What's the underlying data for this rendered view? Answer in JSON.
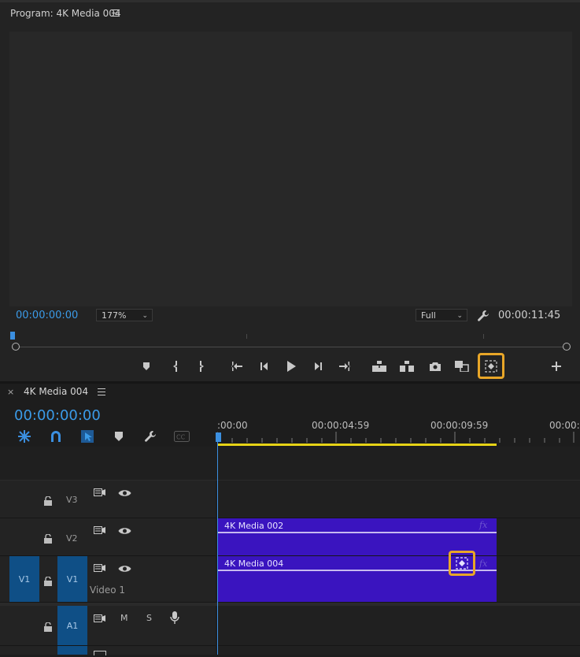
{
  "program": {
    "title": "Program: 4K Media 004",
    "timecode": "00:00:00:00",
    "zoom": "177%",
    "quality": "Full",
    "duration": "00:00:11:45"
  },
  "timeline": {
    "tab_title": "4K Media 004",
    "close": "×",
    "timecode": "00:00:00:00",
    "ruler": [
      ":00:00",
      "00:00:04:59",
      "00:00:09:59",
      "00:00:1"
    ],
    "tracks": {
      "v3": "V3",
      "v2": "V2",
      "v1": "V1",
      "v1_source": "V1",
      "v1_label": "Video 1",
      "a1": "A1",
      "mute": "M",
      "solo": "S"
    },
    "clips": {
      "v2_clip": "4K Media 002",
      "v1_clip": "4K Media 004",
      "fx": "fx"
    }
  },
  "colors": {
    "accent_timecode": "#3b9be8",
    "clip": "#3a14bf",
    "highlight": "#e8a628",
    "work_area": "#e6d316"
  }
}
